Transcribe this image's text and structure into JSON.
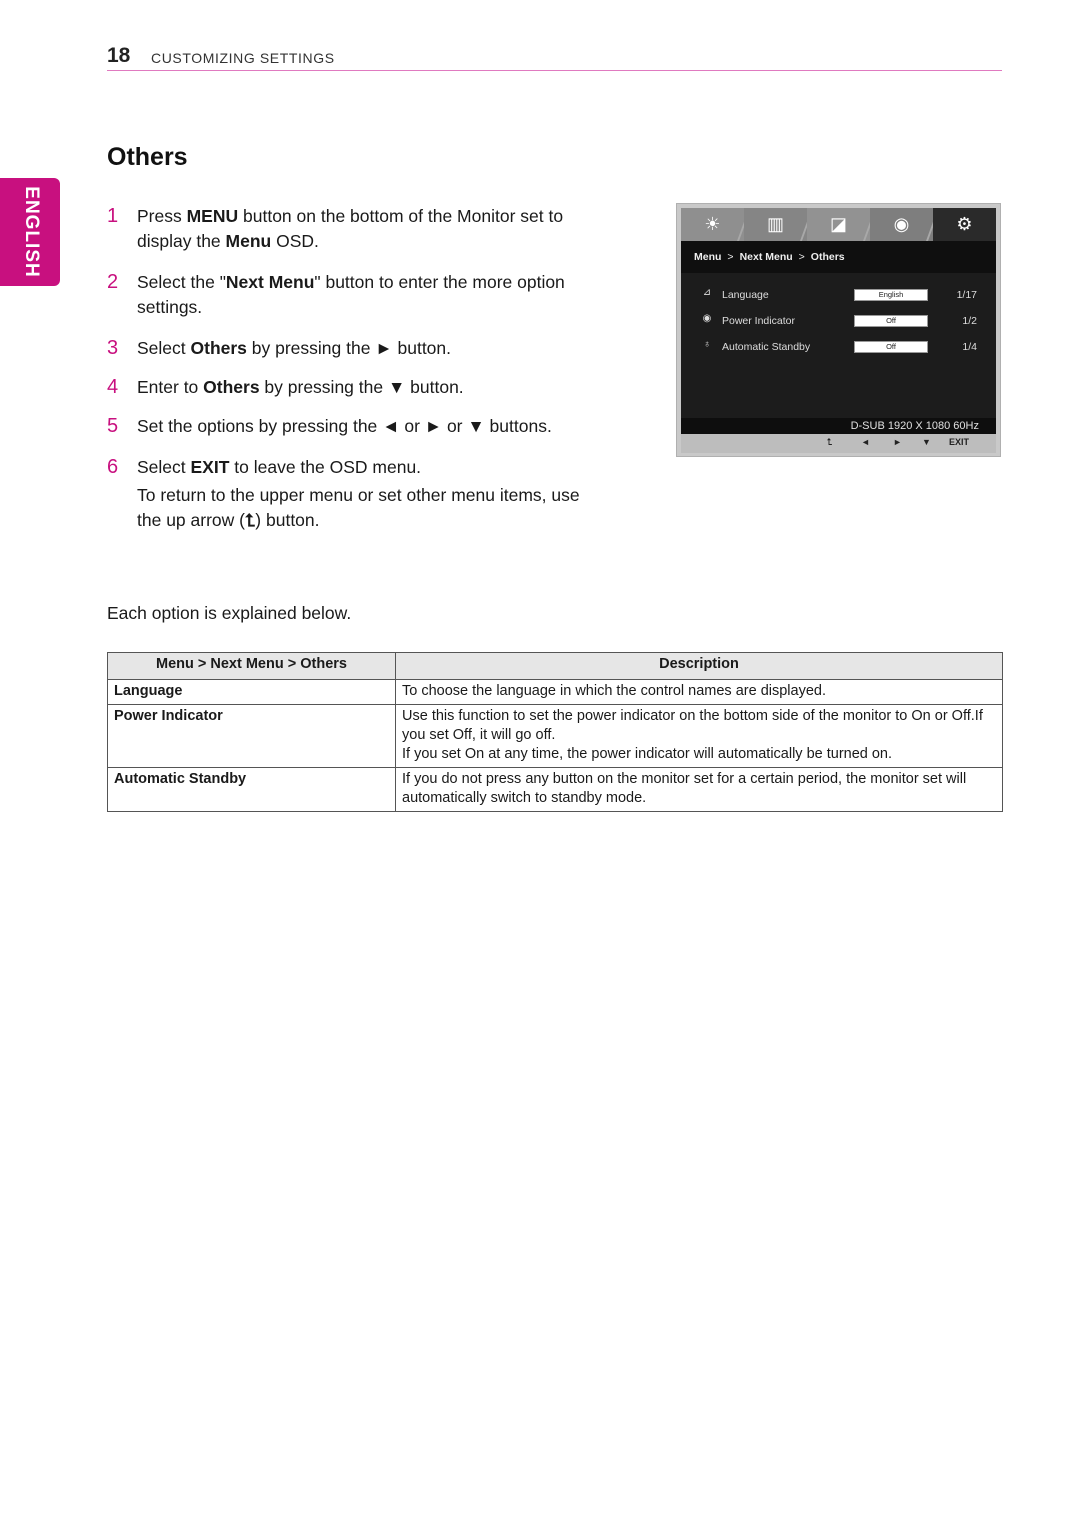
{
  "header": {
    "page_number": "18",
    "section": "CUSTOMIZING SETTINGS"
  },
  "language_tab": "ENGLISH",
  "title": "Others",
  "steps": [
    {
      "num": "1",
      "parts": [
        {
          "t": "Press "
        },
        {
          "b": "MENU"
        },
        {
          "t": " button on the bottom of the Monitor set to display the "
        },
        {
          "b": "Menu"
        },
        {
          "t": " OSD."
        }
      ]
    },
    {
      "num": "2",
      "parts": [
        {
          "t": "Select the \""
        },
        {
          "b": "Next Menu"
        },
        {
          "t": "\" button to enter the more option settings."
        }
      ]
    },
    {
      "num": "3",
      "parts": [
        {
          "t": "Select "
        },
        {
          "b": "Others"
        },
        {
          "t": " by pressing the ► button."
        }
      ]
    },
    {
      "num": "4",
      "parts": [
        {
          "t": "Enter to "
        },
        {
          "b": "Others"
        },
        {
          "t": " by pressing the ▼ button."
        }
      ]
    },
    {
      "num": "5",
      "parts": [
        {
          "t": "Set the options by pressing the ◄ or ► or ▼ buttons."
        }
      ]
    },
    {
      "num": "6",
      "parts": [
        {
          "t": "Select "
        },
        {
          "b": "EXIT"
        },
        {
          "t": " to leave the OSD menu."
        }
      ],
      "note_before": "To return to the upper menu or set other menu items, use the up arrow (",
      "note_icon": "up-arrow-icon",
      "note_after": ") button."
    }
  ],
  "explain": "Each option is explained below.",
  "osd": {
    "tabs": [
      {
        "icon": "brightness-icon",
        "glyph": "☀",
        "active": false
      },
      {
        "icon": "color-bars-icon",
        "glyph": "▥",
        "active": false
      },
      {
        "icon": "picture-icon",
        "glyph": "◪",
        "active": false
      },
      {
        "icon": "disc-icon",
        "glyph": "◉",
        "active": false
      },
      {
        "icon": "gear-icon",
        "glyph": "⚙",
        "active": true
      }
    ],
    "breadcrumb": [
      "Menu",
      "Next Menu",
      "Others"
    ],
    "breadcrumb_sep": ">",
    "rows": [
      {
        "icon": "language-icon",
        "glyph": "⊿",
        "label": "Language",
        "value": "English",
        "count": "1/17"
      },
      {
        "icon": "power-indicator-icon",
        "glyph": "◉",
        "label": "Power Indicator",
        "value": "Off",
        "count": "1/2"
      },
      {
        "icon": "timer-icon",
        "glyph": "♁",
        "label": "Automatic Standby",
        "value": "Off",
        "count": "1/4"
      }
    ],
    "status": "D-SUB 1920 X 1080 60Hz",
    "buttons": {
      "up": "⮤",
      "left": "◄",
      "right": "►",
      "down": "▼",
      "exit": "EXIT"
    }
  },
  "table": {
    "headers": [
      "Menu > Next Menu > Others",
      "Description"
    ],
    "rows": [
      {
        "key": "Language",
        "desc": [
          "To choose the language in which the control names are displayed."
        ]
      },
      {
        "key": "Power Indicator",
        "desc": [
          "Use this function to set the power indicator on the bottom side of the monitor to On or Off.If you set Off, it will go off.",
          "If you set On at any time, the power indicator will automatically be turned on."
        ]
      },
      {
        "key": "Automatic Standby",
        "desc": [
          "If you do not press any button on the monitor set for a certain period, the monitor set will automatically switch to standby mode."
        ]
      }
    ]
  }
}
